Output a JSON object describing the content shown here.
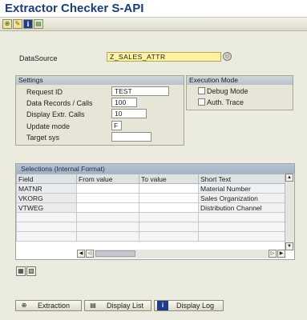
{
  "title": "Extractor Checker S-API",
  "toolbar": {
    "icons": [
      "execute-icon",
      "get-variant-icon",
      "info-icon",
      "save-output-icon"
    ]
  },
  "datasource": {
    "label": "DataSource",
    "value": "Z_SALES_ATTR"
  },
  "settings": {
    "title": "Settings",
    "request_id_label": "Request ID",
    "request_id_value": "TEST",
    "data_records_label": "Data Records / Calls",
    "data_records_value": "100",
    "display_extr_label": "Display Extr. Calls",
    "display_extr_value": "10",
    "update_mode_label": "Update mode",
    "update_mode_value": "F",
    "target_sys_label": "Target sys",
    "target_sys_value": ""
  },
  "execution_mode": {
    "title": "Execution Mode",
    "debug_label": "Debug Mode",
    "debug_checked": false,
    "auth_trace_label": "Auth. Trace",
    "auth_trace_checked": false
  },
  "selections": {
    "title": "Selections (Internal Format)",
    "columns": [
      "Field",
      "From value",
      "To value",
      "Short Text"
    ],
    "rows": [
      {
        "field": "MATNR",
        "from": "",
        "to": "",
        "text": "Material Number"
      },
      {
        "field": "VKORG",
        "from": "",
        "to": "",
        "text": "Sales Organization"
      },
      {
        "field": "VTWEG",
        "from": "",
        "to": "",
        "text": "Distribution Channel"
      }
    ]
  },
  "buttons": {
    "extraction": "Extraction",
    "display_list": "Display List",
    "display_log": "Display Log"
  }
}
